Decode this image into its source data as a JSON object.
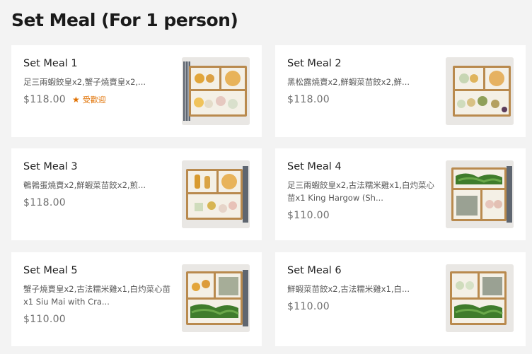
{
  "section": {
    "title": "Set Meal (For 1 person)"
  },
  "meals": [
    {
      "name": "Set Meal 1",
      "description": "足三兩蝦餃皇x2,蟹子燒賣皇x2,...",
      "price": "$118.00",
      "badge": "受歡迎",
      "image_icon": "set-meal-1-photo"
    },
    {
      "name": "Set Meal 2",
      "description": "黑松露燒賣x2,鮮蝦菜苗餃x2,鮮...",
      "price": "$118.00",
      "image_icon": "set-meal-2-photo"
    },
    {
      "name": "Set Meal 3",
      "description": "鵪鶉蛋燒賣x2,鮮蝦菜苗餃x2,煎...",
      "price": "$118.00",
      "image_icon": "set-meal-3-photo"
    },
    {
      "name": "Set Meal 4",
      "description": "足三兩蝦餃皇x2,古法糯米雞x1,白灼菜心苗x1 King Hargow (Sh...",
      "price": "$110.00",
      "image_icon": "set-meal-4-photo"
    },
    {
      "name": "Set Meal 5",
      "description": "蟹子燒賣皇x2,古法糯米雞x1,白灼菜心苗x1 Siu Mai with Cra...",
      "price": "$110.00",
      "image_icon": "set-meal-5-photo"
    },
    {
      "name": "Set Meal 6",
      "description": "鮮蝦菜苗餃x2,古法糯米雞x1,白...",
      "price": "$110.00",
      "image_icon": "set-meal-6-photo"
    }
  ],
  "colors": {
    "background": "#f3f3f3",
    "card": "#ffffff",
    "badge": "#e07000",
    "box_kraft": "#b98a4e"
  }
}
